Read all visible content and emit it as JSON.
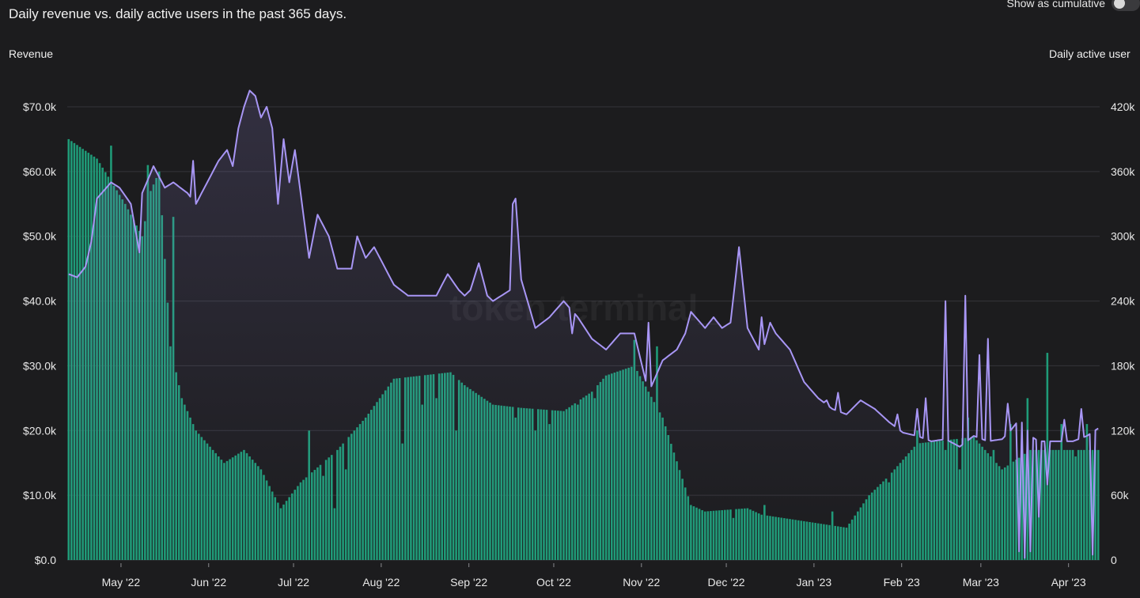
{
  "header": {
    "title": "Daily revenue vs. daily active users in the past 365 days.",
    "toggle_label": "Show as cumulative",
    "toggle_on": false
  },
  "watermark": "token terminal_",
  "colors": {
    "bars": "#1f9b78",
    "line": "#a896f5",
    "grid": "#34343a"
  },
  "chart_data": {
    "type": "bar+line",
    "title": "Daily revenue vs. daily active users in the past 365 days.",
    "left_axis": {
      "label": "Revenue",
      "range": [
        0,
        70000
      ],
      "ticks": [
        0,
        10000,
        20000,
        30000,
        40000,
        50000,
        60000,
        70000
      ],
      "tick_labels": [
        "$0.0",
        "$10.0k",
        "$20.0k",
        "$30.0k",
        "$40.0k",
        "$50.0k",
        "$60.0k",
        "$70.0k"
      ]
    },
    "right_axis": {
      "label": "Daily active user",
      "range": [
        0,
        420000
      ],
      "ticks": [
        0,
        60000,
        120000,
        180000,
        240000,
        300000,
        360000,
        420000
      ],
      "tick_labels": [
        "0",
        "60k",
        "120k",
        "180k",
        "240k",
        "300k",
        "360k",
        "420k"
      ]
    },
    "x_axis": {
      "start_date": "2022-04-12",
      "days": 365,
      "tick_labels": [
        "May '22",
        "Jun '22",
        "Jul '22",
        "Aug '22",
        "Sep '22",
        "Oct '22",
        "Nov '22",
        "Dec '22",
        "Jan '23",
        "Feb '23",
        "Mar '23",
        "Apr '23"
      ],
      "tick_dates": [
        "2022-05-01",
        "2022-06-01",
        "2022-07-01",
        "2022-08-01",
        "2022-09-01",
        "2022-10-01",
        "2022-11-01",
        "2022-12-01",
        "2023-01-01",
        "2023-02-01",
        "2023-03-01",
        "2023-04-01"
      ]
    },
    "grid": "horizontal",
    "series": [
      {
        "type": "bar",
        "axis": "left",
        "color": "#1f9b78",
        "keypoints": [
          [
            0,
            65000
          ],
          [
            10,
            62000
          ],
          [
            20,
            55000
          ],
          [
            26,
            50000
          ],
          [
            29,
            57000
          ],
          [
            32,
            60000
          ],
          [
            36,
            33000
          ],
          [
            40,
            25000
          ],
          [
            45,
            20000
          ],
          [
            55,
            15000
          ],
          [
            62,
            17000
          ],
          [
            68,
            14000
          ],
          [
            75,
            8000
          ],
          [
            82,
            12000
          ],
          [
            95,
            17000
          ],
          [
            105,
            22000
          ],
          [
            115,
            28000
          ],
          [
            125,
            28500
          ],
          [
            135,
            29000
          ],
          [
            140,
            27000
          ],
          [
            150,
            24000
          ],
          [
            160,
            23500
          ],
          [
            175,
            23000
          ],
          [
            185,
            26000
          ],
          [
            190,
            28500
          ],
          [
            200,
            30000
          ],
          [
            210,
            22000
          ],
          [
            220,
            8500
          ],
          [
            225,
            7500
          ],
          [
            240,
            8000
          ],
          [
            245,
            7000
          ],
          [
            260,
            6000
          ],
          [
            275,
            5000
          ],
          [
            283,
            10000
          ],
          [
            290,
            13000
          ],
          [
            300,
            18000
          ],
          [
            320,
            19000
          ],
          [
            330,
            14000
          ],
          [
            340,
            17000
          ],
          [
            350,
            17000
          ],
          [
            364,
            17000
          ]
        ],
        "spikes": [
          [
            15,
            64000
          ],
          [
            28,
            61000
          ],
          [
            37,
            53000
          ],
          [
            85,
            20000
          ],
          [
            90,
            13000
          ],
          [
            94,
            8000
          ],
          [
            98,
            14000
          ],
          [
            118,
            18000
          ],
          [
            125,
            24000
          ],
          [
            130,
            25000
          ],
          [
            137,
            20000
          ],
          [
            158,
            22000
          ],
          [
            165,
            20000
          ],
          [
            170,
            21000
          ],
          [
            180,
            24000
          ],
          [
            186,
            25000
          ],
          [
            200,
            34000
          ],
          [
            208,
            33000
          ],
          [
            235,
            6500
          ],
          [
            246,
            8500
          ],
          [
            270,
            7500
          ],
          [
            290,
            12000
          ],
          [
            300,
            20000
          ],
          [
            310,
            17000
          ],
          [
            315,
            14000
          ],
          [
            318,
            22000
          ],
          [
            327,
            17000
          ],
          [
            333,
            21000
          ],
          [
            339,
            25000
          ],
          [
            346,
            32000
          ],
          [
            351,
            21000
          ],
          [
            356,
            16000
          ],
          [
            360,
            21000
          ]
        ]
      },
      {
        "type": "line",
        "axis": "right",
        "color": "#a896f5",
        "keypoints": [
          [
            0,
            265000
          ],
          [
            3,
            262000
          ],
          [
            6,
            272000
          ],
          [
            8,
            295000
          ],
          [
            10,
            335000
          ],
          [
            15,
            350000
          ],
          [
            18,
            345000
          ],
          [
            22,
            330000
          ],
          [
            25,
            285000
          ],
          [
            26,
            340000
          ],
          [
            30,
            365000
          ],
          [
            34,
            345000
          ],
          [
            37,
            350000
          ],
          [
            42,
            340000
          ],
          [
            45,
            330000
          ],
          [
            48,
            345000
          ],
          [
            53,
            370000
          ],
          [
            56,
            380000
          ],
          [
            58,
            365000
          ],
          [
            60,
            400000
          ],
          [
            62,
            420000
          ],
          [
            64,
            435000
          ],
          [
            66,
            430000
          ],
          [
            68,
            410000
          ],
          [
            70,
            420000
          ],
          [
            72,
            400000
          ],
          [
            74,
            330000
          ],
          [
            76,
            390000
          ],
          [
            78,
            350000
          ],
          [
            80,
            380000
          ],
          [
            83,
            320000
          ],
          [
            85,
            280000
          ],
          [
            88,
            320000
          ],
          [
            92,
            300000
          ],
          [
            95,
            270000
          ],
          [
            100,
            270000
          ],
          [
            102,
            300000
          ],
          [
            105,
            280000
          ],
          [
            108,
            290000
          ],
          [
            112,
            270000
          ],
          [
            115,
            255000
          ],
          [
            120,
            245000
          ],
          [
            125,
            245000
          ],
          [
            130,
            245000
          ],
          [
            134,
            265000
          ],
          [
            138,
            250000
          ],
          [
            140,
            245000
          ],
          [
            142,
            250000
          ],
          [
            145,
            275000
          ],
          [
            148,
            245000
          ],
          [
            150,
            240000
          ],
          [
            153,
            245000
          ],
          [
            156,
            250000
          ],
          [
            158,
            335000
          ],
          [
            160,
            260000
          ],
          [
            165,
            215000
          ],
          [
            170,
            225000
          ],
          [
            175,
            240000
          ],
          [
            180,
            225000
          ],
          [
            185,
            205000
          ],
          [
            190,
            195000
          ],
          [
            195,
            210000
          ],
          [
            200,
            210000
          ],
          [
            205,
            155000
          ],
          [
            210,
            185000
          ],
          [
            215,
            195000
          ],
          [
            218,
            210000
          ],
          [
            220,
            230000
          ],
          [
            225,
            215000
          ],
          [
            228,
            225000
          ],
          [
            231,
            215000
          ],
          [
            234,
            220000
          ],
          [
            237,
            290000
          ],
          [
            240,
            215000
          ],
          [
            245,
            190000
          ],
          [
            248,
            220000
          ],
          [
            250,
            210000
          ],
          [
            255,
            195000
          ],
          [
            260,
            165000
          ],
          [
            265,
            150000
          ],
          [
            270,
            140000
          ],
          [
            275,
            135000
          ],
          [
            280,
            148000
          ],
          [
            285,
            140000
          ],
          [
            290,
            128000
          ],
          [
            295,
            118000
          ],
          [
            300,
            115000
          ],
          [
            305,
            110000
          ],
          [
            310,
            112000
          ],
          [
            315,
            105000
          ],
          [
            320,
            115000
          ],
          [
            325,
            110000
          ],
          [
            330,
            112000
          ],
          [
            333,
            120000
          ],
          [
            336,
            130000
          ],
          [
            338,
            125000
          ],
          [
            340,
            115000
          ],
          [
            343,
            110000
          ],
          [
            345,
            110000
          ],
          [
            350,
            110000
          ],
          [
            355,
            110000
          ],
          [
            360,
            115000
          ],
          [
            364,
            122000
          ]
        ],
        "spikes": [
          [
            44,
            370000
          ],
          [
            157,
            330000
          ],
          [
            178,
            210000
          ],
          [
            205,
            220000
          ],
          [
            245,
            225000
          ],
          [
            268,
            148000
          ],
          [
            272,
            155000
          ],
          [
            293,
            135000
          ],
          [
            300,
            140000
          ],
          [
            303,
            150000
          ],
          [
            310,
            240000
          ],
          [
            317,
            245000
          ],
          [
            322,
            190000
          ],
          [
            325,
            205000
          ],
          [
            332,
            145000
          ],
          [
            336,
            90000
          ],
          [
            340,
            8000
          ],
          [
            346,
            70000
          ],
          [
            352,
            130000
          ],
          [
            358,
            140000
          ]
        ],
        "dips": [
          [
            336,
            8000
          ],
          [
            338,
            2000
          ],
          [
            343,
            40000
          ],
          [
            362,
            5000
          ]
        ]
      }
    ]
  }
}
